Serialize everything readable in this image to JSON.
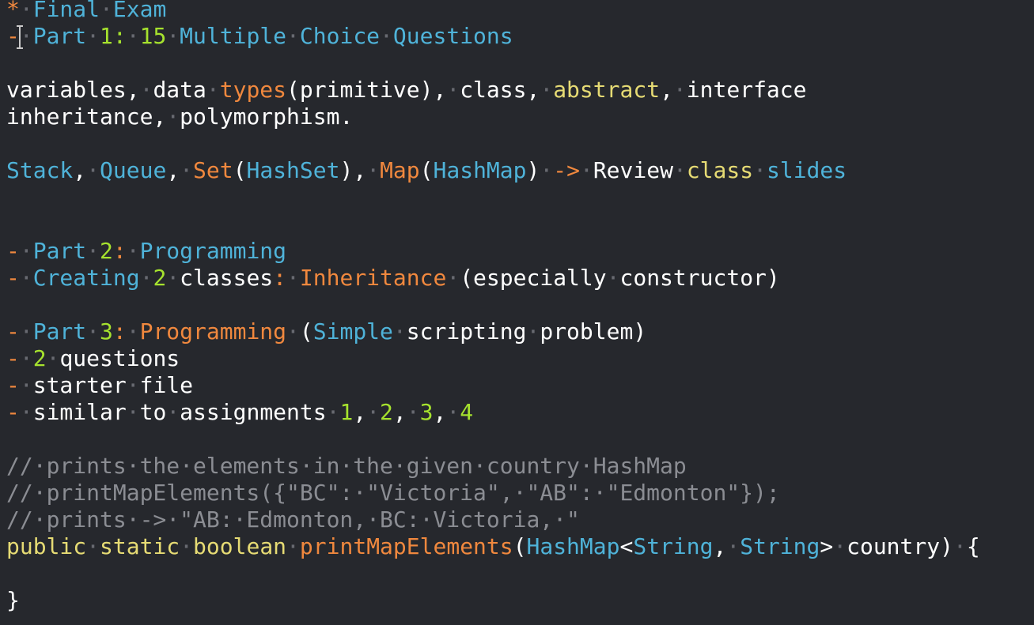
{
  "colors": {
    "background": "#26282d",
    "whitespace_dot": "#686a71"
  },
  "editor": {
    "lines": [
      {
        "tokens": [
          {
            "t": "*",
            "c": "#f0883e"
          },
          {
            "t": "·",
            "c": "#686a71"
          },
          {
            "t": "Final",
            "c": "#4fb3d9"
          },
          {
            "t": "·",
            "c": "#686a71"
          },
          {
            "t": "Exam",
            "c": "#4fb3d9"
          }
        ]
      },
      {
        "tokens": [
          {
            "t": "-",
            "c": "#f0883e"
          },
          {
            "t": "·",
            "c": "#686a71"
          },
          {
            "t": "Part",
            "c": "#4fb3d9"
          },
          {
            "t": "·",
            "c": "#686a71"
          },
          {
            "t": "1:",
            "c": "#a6e22e"
          },
          {
            "t": "·",
            "c": "#686a71"
          },
          {
            "t": "15",
            "c": "#a6e22e"
          },
          {
            "t": "·",
            "c": "#686a71"
          },
          {
            "t": "Multiple",
            "c": "#4fb3d9"
          },
          {
            "t": "·",
            "c": "#686a71"
          },
          {
            "t": "Choice",
            "c": "#4fb3d9"
          },
          {
            "t": "·",
            "c": "#686a71"
          },
          {
            "t": "Questions",
            "c": "#4fb3d9"
          }
        ]
      },
      {
        "tokens": []
      },
      {
        "tokens": [
          {
            "t": "variables,",
            "c": "#ffffff"
          },
          {
            "t": "·",
            "c": "#686a71"
          },
          {
            "t": "data",
            "c": "#ffffff"
          },
          {
            "t": "·",
            "c": "#686a71"
          },
          {
            "t": "types",
            "c": "#f0883e"
          },
          {
            "t": "(primitive),",
            "c": "#ffffff"
          },
          {
            "t": "·",
            "c": "#686a71"
          },
          {
            "t": "class,",
            "c": "#ffffff"
          },
          {
            "t": "·",
            "c": "#686a71"
          },
          {
            "t": "abstract",
            "c": "#e6db74"
          },
          {
            "t": ",",
            "c": "#ffffff"
          },
          {
            "t": "·",
            "c": "#686a71"
          },
          {
            "t": "interface",
            "c": "#ffffff"
          }
        ]
      },
      {
        "tokens": [
          {
            "t": "inheritance,",
            "c": "#ffffff"
          },
          {
            "t": "·",
            "c": "#686a71"
          },
          {
            "t": "polymorphism.",
            "c": "#ffffff"
          }
        ]
      },
      {
        "tokens": []
      },
      {
        "tokens": [
          {
            "t": "Stack",
            "c": "#4fb3d9"
          },
          {
            "t": ",",
            "c": "#ffffff"
          },
          {
            "t": "·",
            "c": "#686a71"
          },
          {
            "t": "Queue",
            "c": "#4fb3d9"
          },
          {
            "t": ",",
            "c": "#ffffff"
          },
          {
            "t": "·",
            "c": "#686a71"
          },
          {
            "t": "Set",
            "c": "#f0883e"
          },
          {
            "t": "(",
            "c": "#ffffff"
          },
          {
            "t": "HashSet",
            "c": "#4fb3d9"
          },
          {
            "t": "),",
            "c": "#ffffff"
          },
          {
            "t": "·",
            "c": "#686a71"
          },
          {
            "t": "Map",
            "c": "#f0883e"
          },
          {
            "t": "(",
            "c": "#ffffff"
          },
          {
            "t": "HashMap",
            "c": "#4fb3d9"
          },
          {
            "t": ")",
            "c": "#ffffff"
          },
          {
            "t": "·",
            "c": "#686a71"
          },
          {
            "t": "->",
            "c": "#f0883e"
          },
          {
            "t": "·",
            "c": "#686a71"
          },
          {
            "t": "Review",
            "c": "#ffffff"
          },
          {
            "t": "·",
            "c": "#686a71"
          },
          {
            "t": "class",
            "c": "#e6db74"
          },
          {
            "t": "·",
            "c": "#686a71"
          },
          {
            "t": "slides",
            "c": "#4fb3d9"
          }
        ]
      },
      {
        "tokens": []
      },
      {
        "tokens": []
      },
      {
        "tokens": [
          {
            "t": "-",
            "c": "#f0883e"
          },
          {
            "t": "·",
            "c": "#686a71"
          },
          {
            "t": "Part",
            "c": "#4fb3d9"
          },
          {
            "t": "·",
            "c": "#686a71"
          },
          {
            "t": "2",
            "c": "#a6e22e"
          },
          {
            "t": ":",
            "c": "#f0883e"
          },
          {
            "t": "·",
            "c": "#686a71"
          },
          {
            "t": "Programming",
            "c": "#4fb3d9"
          }
        ]
      },
      {
        "tokens": [
          {
            "t": "-",
            "c": "#f0883e"
          },
          {
            "t": "·",
            "c": "#686a71"
          },
          {
            "t": "Creating",
            "c": "#4fb3d9"
          },
          {
            "t": "·",
            "c": "#686a71"
          },
          {
            "t": "2",
            "c": "#a6e22e"
          },
          {
            "t": "·",
            "c": "#686a71"
          },
          {
            "t": "classes",
            "c": "#ffffff"
          },
          {
            "t": ":",
            "c": "#f0883e"
          },
          {
            "t": "·",
            "c": "#686a71"
          },
          {
            "t": "Inheritance",
            "c": "#f0883e"
          },
          {
            "t": "·",
            "c": "#686a71"
          },
          {
            "t": "(especially",
            "c": "#ffffff"
          },
          {
            "t": "·",
            "c": "#686a71"
          },
          {
            "t": "constructor)",
            "c": "#ffffff"
          }
        ]
      },
      {
        "tokens": []
      },
      {
        "tokens": [
          {
            "t": "-",
            "c": "#f0883e"
          },
          {
            "t": "·",
            "c": "#686a71"
          },
          {
            "t": "Part",
            "c": "#4fb3d9"
          },
          {
            "t": "·",
            "c": "#686a71"
          },
          {
            "t": "3",
            "c": "#a6e22e"
          },
          {
            "t": ":",
            "c": "#f0883e"
          },
          {
            "t": "·",
            "c": "#686a71"
          },
          {
            "t": "Programming",
            "c": "#f0883e"
          },
          {
            "t": "·",
            "c": "#686a71"
          },
          {
            "t": "(",
            "c": "#ffffff"
          },
          {
            "t": "Simple",
            "c": "#4fb3d9"
          },
          {
            "t": "·",
            "c": "#686a71"
          },
          {
            "t": "scripting",
            "c": "#ffffff"
          },
          {
            "t": "·",
            "c": "#686a71"
          },
          {
            "t": "problem)",
            "c": "#ffffff"
          }
        ]
      },
      {
        "tokens": [
          {
            "t": "-",
            "c": "#f0883e"
          },
          {
            "t": "·",
            "c": "#686a71"
          },
          {
            "t": "2",
            "c": "#a6e22e"
          },
          {
            "t": "·",
            "c": "#686a71"
          },
          {
            "t": "questions",
            "c": "#ffffff"
          }
        ]
      },
      {
        "tokens": [
          {
            "t": "-",
            "c": "#f0883e"
          },
          {
            "t": "·",
            "c": "#686a71"
          },
          {
            "t": "starter",
            "c": "#ffffff"
          },
          {
            "t": "·",
            "c": "#686a71"
          },
          {
            "t": "file",
            "c": "#ffffff"
          }
        ]
      },
      {
        "tokens": [
          {
            "t": "-",
            "c": "#f0883e"
          },
          {
            "t": "·",
            "c": "#686a71"
          },
          {
            "t": "similar",
            "c": "#ffffff"
          },
          {
            "t": "·",
            "c": "#686a71"
          },
          {
            "t": "to",
            "c": "#ffffff"
          },
          {
            "t": "·",
            "c": "#686a71"
          },
          {
            "t": "assignments",
            "c": "#ffffff"
          },
          {
            "t": "·",
            "c": "#686a71"
          },
          {
            "t": "1",
            "c": "#a6e22e"
          },
          {
            "t": ",",
            "c": "#ffffff"
          },
          {
            "t": "·",
            "c": "#686a71"
          },
          {
            "t": "2",
            "c": "#a6e22e"
          },
          {
            "t": ",",
            "c": "#ffffff"
          },
          {
            "t": "·",
            "c": "#686a71"
          },
          {
            "t": "3",
            "c": "#a6e22e"
          },
          {
            "t": ",",
            "c": "#ffffff"
          },
          {
            "t": "·",
            "c": "#686a71"
          },
          {
            "t": "4",
            "c": "#a6e22e"
          }
        ]
      },
      {
        "tokens": []
      },
      {
        "tokens": [
          {
            "t": "//·prints·the·elements·in·the·given·country·HashMap",
            "c": "#8b8d93"
          }
        ]
      },
      {
        "tokens": [
          {
            "t": "//·printMapElements({\"BC\":·\"Victoria\",·\"AB\":·\"Edmonton\"});",
            "c": "#8b8d93"
          }
        ]
      },
      {
        "tokens": [
          {
            "t": "//·prints·->·\"AB:·Edmonton,·BC:·Victoria,·\"",
            "c": "#8b8d93"
          }
        ]
      },
      {
        "tokens": [
          {
            "t": "public",
            "c": "#e6db74"
          },
          {
            "t": "·",
            "c": "#686a71"
          },
          {
            "t": "static",
            "c": "#e6db74"
          },
          {
            "t": "·",
            "c": "#686a71"
          },
          {
            "t": "boolean",
            "c": "#e6db74"
          },
          {
            "t": "·",
            "c": "#686a71"
          },
          {
            "t": "printMapElements",
            "c": "#f0883e"
          },
          {
            "t": "(",
            "c": "#ffffff"
          },
          {
            "t": "HashMap",
            "c": "#4fb3d9"
          },
          {
            "t": "<",
            "c": "#ffffff"
          },
          {
            "t": "String",
            "c": "#4fb3d9"
          },
          {
            "t": ",",
            "c": "#ffffff"
          },
          {
            "t": "·",
            "c": "#686a71"
          },
          {
            "t": "String",
            "c": "#4fb3d9"
          },
          {
            "t": ">",
            "c": "#ffffff"
          },
          {
            "t": "·",
            "c": "#686a71"
          },
          {
            "t": "country)",
            "c": "#ffffff"
          },
          {
            "t": "·",
            "c": "#686a71"
          },
          {
            "t": "{",
            "c": "#ffffff"
          }
        ]
      },
      {
        "tokens": []
      },
      {
        "tokens": [
          {
            "t": "}",
            "c": "#ffffff"
          }
        ]
      }
    ]
  }
}
